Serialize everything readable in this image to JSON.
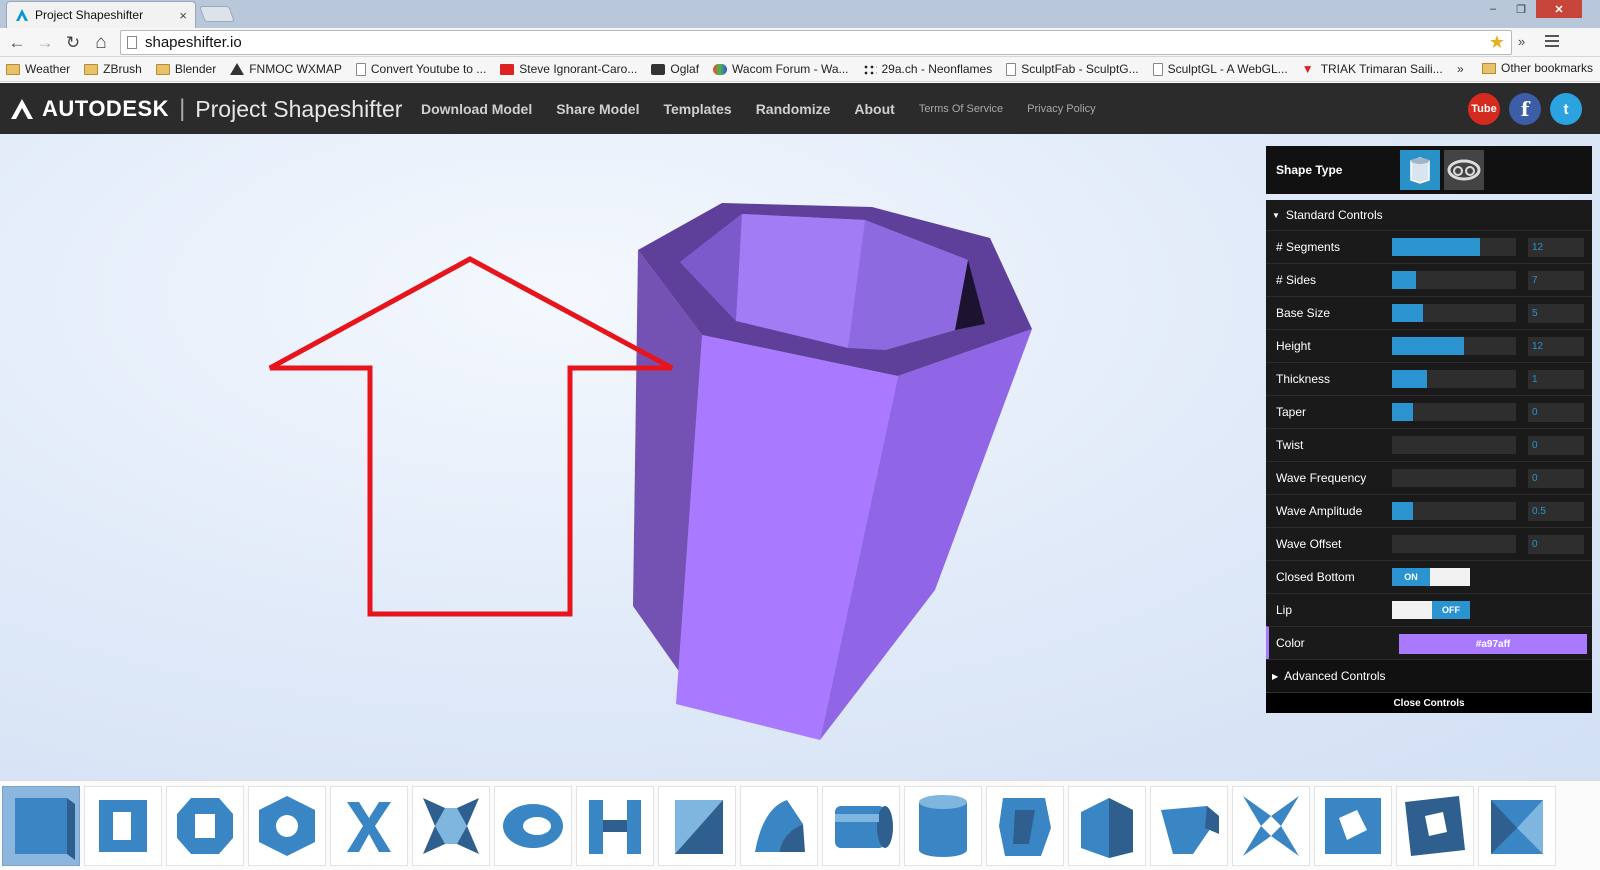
{
  "browser": {
    "tab_title": "Project Shapeshifter",
    "tab_close": "×",
    "url": "shapeshifter.io",
    "window_controls": {
      "minimize": "–",
      "maximize": "❐",
      "close": "✕"
    },
    "nav": {
      "back": "←",
      "forward": "→",
      "reload": "↻",
      "home": "⌂"
    },
    "star": "★",
    "extensions_more": "»",
    "bookmarks": [
      {
        "label": "Weather",
        "icon": "folder-icon"
      },
      {
        "label": "ZBrush",
        "icon": "folder-icon"
      },
      {
        "label": "Blender",
        "icon": "folder-icon"
      },
      {
        "label": "FNMOC WXMAP",
        "icon": "warning-triangle-icon"
      },
      {
        "label": "Convert Youtube to ...",
        "icon": "page-icon"
      },
      {
        "label": "Steve Ignorant-Caro...",
        "icon": "youtube-icon"
      },
      {
        "label": "Oglaf",
        "icon": "oglaf-icon"
      },
      {
        "label": "Wacom Forum - Wa...",
        "icon": "wacom-icon"
      },
      {
        "label": "29a.ch - Neonflames",
        "icon": "dots-icon"
      },
      {
        "label": "SculptFab - SculptG...",
        "icon": "page-icon"
      },
      {
        "label": "SculptGL - A WebGL...",
        "icon": "page-icon"
      },
      {
        "label": "TRIAK Trimaran Saili...",
        "icon": "triak-icon"
      }
    ],
    "bookmarks_overflow": "»",
    "other_bookmarks": "Other bookmarks"
  },
  "app": {
    "brand": "AUTODESK",
    "separator": "|",
    "project_title": "Project Shapeshifter",
    "nav_primary": [
      "Download Model",
      "Share Model",
      "Templates",
      "Randomize",
      "About"
    ],
    "nav_secondary": [
      "Terms Of Service",
      "Privacy Policy"
    ],
    "social": {
      "youtube": "Tube",
      "facebook": "f",
      "twitter": "t"
    }
  },
  "panel": {
    "shape_type_label": "Shape Type",
    "shape_types": [
      {
        "name": "hexagonal-vase-icon",
        "active": true
      },
      {
        "name": "torus-shape-icon",
        "active": false
      }
    ],
    "standard_controls_label": "Standard Controls",
    "controls": [
      {
        "label": "# Segments",
        "value": "12",
        "level": 0.71
      },
      {
        "label": "# Sides",
        "value": "7",
        "level": 0.19
      },
      {
        "label": "Base Size",
        "value": "5",
        "level": 0.25
      },
      {
        "label": "Height",
        "value": "12",
        "level": 0.58
      },
      {
        "label": "Thickness",
        "value": "1",
        "level": 0.28
      },
      {
        "label": "Taper",
        "value": "0",
        "level": 0.17
      },
      {
        "label": "Twist",
        "value": "0",
        "level": 0
      },
      {
        "label": "Wave Frequency",
        "value": "0",
        "level": 0
      },
      {
        "label": "Wave Amplitude",
        "value": "0.5",
        "level": 0.17
      },
      {
        "label": "Wave Offset",
        "value": "0",
        "level": 0
      }
    ],
    "closed_bottom": {
      "label": "Closed Bottom",
      "state": "ON"
    },
    "lip": {
      "label": "Lip",
      "state": "OFF"
    },
    "color": {
      "label": "Color",
      "value": "#a97aff"
    },
    "advanced_controls_label": "Advanced Controls",
    "close_controls_label": "Close Controls"
  },
  "annotation": {
    "color": "#e8141c"
  },
  "templates": [
    "box-template-icon",
    "square-frame-template-icon",
    "octagon-ring-template-icon",
    "hex-nut-template-icon",
    "x-cross-template-icon",
    "twisted-x-template-icon",
    "eye-ring-template-icon",
    "h-frame-template-icon",
    "wedge-template-icon",
    "curved-arch-template-icon",
    "cylinder-side-template-icon",
    "cylinder-template-icon",
    "twisted-column-template-icon",
    "stepped-block-template-icon",
    "funnel-block-template-icon",
    "star-frame-template-icon",
    "rotated-square-template-icon",
    "tilted-frame-template-icon",
    "split-box-template-icon"
  ]
}
